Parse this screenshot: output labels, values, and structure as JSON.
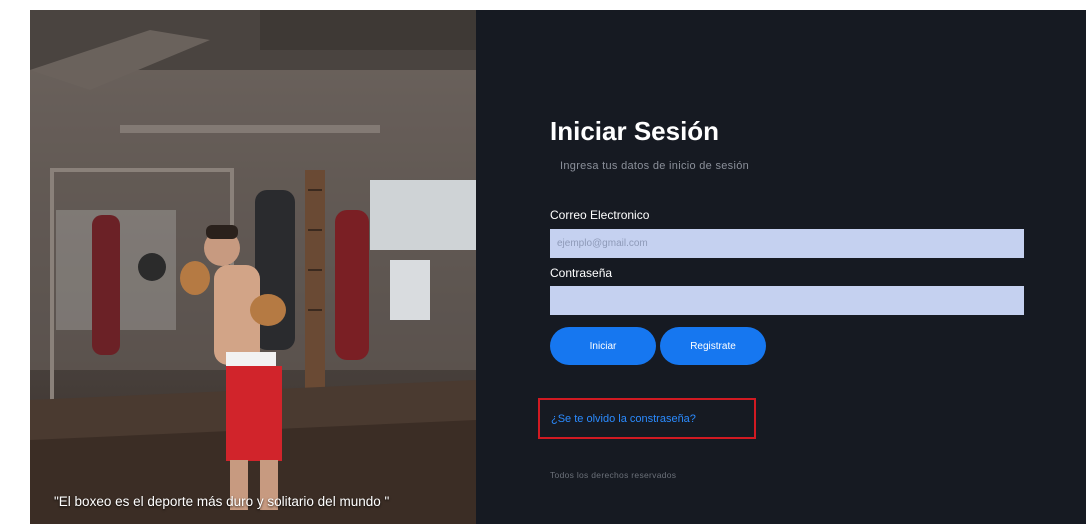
{
  "hero": {
    "quote": "\"El boxeo es el deporte más duro y solitario del mundo \""
  },
  "login": {
    "title": "Iniciar Sesión",
    "subtitle": "Ingresa tus datos de inicio de sesión",
    "email_label": "Correo Electronico",
    "email_placeholder": "ejemplo@gmail.com",
    "email_value": "",
    "password_label": "Contraseña",
    "password_value": "",
    "login_button": "Iniciar",
    "register_button": "Registrate",
    "forgot_link": "¿Se te olvido la constraseña?",
    "footer": "Todos los derechos reservados"
  },
  "colors": {
    "background": "#161a22",
    "input_fill": "#c5d1f0",
    "button": "#1677f0",
    "link": "#2b8bff",
    "highlight_border": "#d11a22"
  }
}
